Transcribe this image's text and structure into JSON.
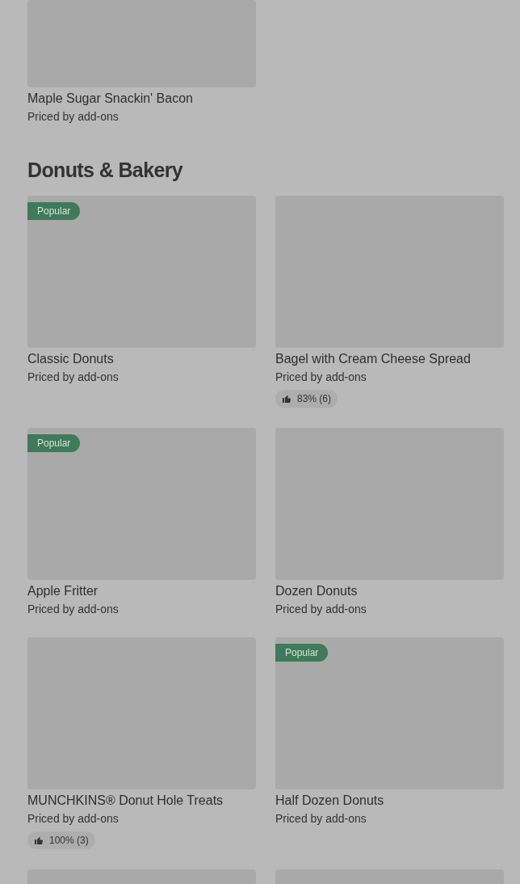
{
  "previous_items": [
    {
      "title": "Maple Sugar Snackin' Bacon",
      "subtitle": "Priced by add-ons"
    }
  ],
  "section": {
    "title": "Donuts & Bakery",
    "items": [
      {
        "kind": "item",
        "badge": "Popular",
        "title": "Classic Donuts",
        "subtitle": "Priced by add-ons"
      },
      {
        "kind": "item",
        "title": "Bagel with Cream Cheese Spread",
        "subtitle": "Priced by add-ons",
        "rating": "83% (6)"
      },
      {
        "kind": "item",
        "badge": "Popular",
        "title": "Apple Fritter",
        "subtitle": "Priced by add-ons"
      },
      {
        "kind": "item",
        "title": "Dozen Donuts",
        "subtitle": "Priced by add-ons"
      },
      {
        "kind": "item",
        "title": "MUNCHKINS® Donut Hole Treats",
        "subtitle": "Priced by add-ons",
        "rating": "100% (3)"
      },
      {
        "kind": "item",
        "badge": "Popular",
        "title": "Half Dozen Donuts",
        "subtitle": "Priced by add-ons"
      },
      {
        "kind": "cut_off"
      },
      {
        "kind": "cut_off"
      }
    ]
  }
}
